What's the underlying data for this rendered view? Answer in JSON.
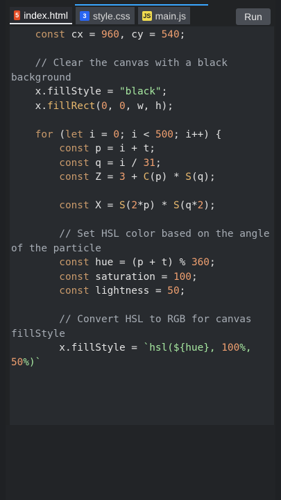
{
  "tabs": [
    {
      "label": "index.html",
      "icon": "html5-icon",
      "active": true
    },
    {
      "label": "style.css",
      "icon": "css3-icon",
      "active": false
    },
    {
      "label": "main.js",
      "icon": "js-icon",
      "active": false
    }
  ],
  "run_label": "Run",
  "colors": {
    "accent": "#3aa6ff",
    "editor_bg": "#282b2f",
    "keyword": "#c99a6b",
    "number": "#f0a070",
    "string": "#a6e7a0",
    "comment": "#a7adb5"
  },
  "code_lines": [
    [
      [
        "kw",
        "    const"
      ],
      [
        "pn",
        " cx = "
      ],
      [
        "num",
        "960"
      ],
      [
        "pn",
        ", cy = "
      ],
      [
        "num",
        "540"
      ],
      [
        "pn",
        ";"
      ]
    ],
    [],
    [
      [
        "cm",
        "    // Clear the canvas with a black"
      ]
    ],
    [
      [
        "cm",
        "background"
      ]
    ],
    [
      [
        "pn",
        "    x.fillStyle = "
      ],
      [
        "str",
        "\"black\""
      ],
      [
        "pn",
        ";"
      ]
    ],
    [
      [
        "pn",
        "    x."
      ],
      [
        "fn",
        "fillRect"
      ],
      [
        "pn",
        "("
      ],
      [
        "num",
        "0"
      ],
      [
        "pn",
        ", "
      ],
      [
        "num",
        "0"
      ],
      [
        "pn",
        ", w, h);"
      ]
    ],
    [],
    [
      [
        "kw",
        "    for"
      ],
      [
        "pn",
        " ("
      ],
      [
        "kw",
        "let"
      ],
      [
        "pn",
        " i = "
      ],
      [
        "num",
        "0"
      ],
      [
        "pn",
        "; i < "
      ],
      [
        "num",
        "500"
      ],
      [
        "pn",
        "; i++) {"
      ]
    ],
    [
      [
        "kw",
        "        const"
      ],
      [
        "pn",
        " p = i + t;"
      ]
    ],
    [
      [
        "kw",
        "        const"
      ],
      [
        "pn",
        " q = i / "
      ],
      [
        "num",
        "31"
      ],
      [
        "pn",
        ";"
      ]
    ],
    [
      [
        "kw",
        "        const"
      ],
      [
        "pn",
        " Z = "
      ],
      [
        "num",
        "3"
      ],
      [
        "pn",
        " + "
      ],
      [
        "fn",
        "C"
      ],
      [
        "pn",
        "(p) * "
      ],
      [
        "fn",
        "S"
      ],
      [
        "pn",
        "(q);"
      ]
    ],
    [],
    [
      [
        "kw",
        "        const"
      ],
      [
        "pn",
        " X = "
      ],
      [
        "fn",
        "S"
      ],
      [
        "pn",
        "("
      ],
      [
        "num",
        "2"
      ],
      [
        "pn",
        "*p) * "
      ],
      [
        "fn",
        "S"
      ],
      [
        "pn",
        "(q*"
      ],
      [
        "num",
        "2"
      ],
      [
        "pn",
        ");"
      ]
    ],
    [],
    [
      [
        "cm",
        "        // Set HSL color based on the angle"
      ]
    ],
    [
      [
        "cm",
        "of the particle"
      ]
    ],
    [
      [
        "kw",
        "        const"
      ],
      [
        "pn",
        " hue = (p + t) % "
      ],
      [
        "num",
        "360"
      ],
      [
        "pn",
        ";"
      ]
    ],
    [
      [
        "kw",
        "        const"
      ],
      [
        "pn",
        " saturation = "
      ],
      [
        "num",
        "100"
      ],
      [
        "pn",
        ";"
      ]
    ],
    [
      [
        "kw",
        "        const"
      ],
      [
        "pn",
        " lightness = "
      ],
      [
        "num",
        "50"
      ],
      [
        "pn",
        ";"
      ]
    ],
    [],
    [
      [
        "cm",
        "        // Convert HSL to RGB for canvas"
      ]
    ],
    [
      [
        "cm",
        "fillStyle"
      ]
    ],
    [
      [
        "pn",
        "        x.fillStyle = "
      ],
      [
        "str",
        "`hsl(${hue}, "
      ],
      [
        "num",
        "100"
      ],
      [
        "str",
        "%,"
      ]
    ],
    [
      [
        "num",
        "50"
      ],
      [
        "str",
        "%)`"
      ]
    ]
  ]
}
